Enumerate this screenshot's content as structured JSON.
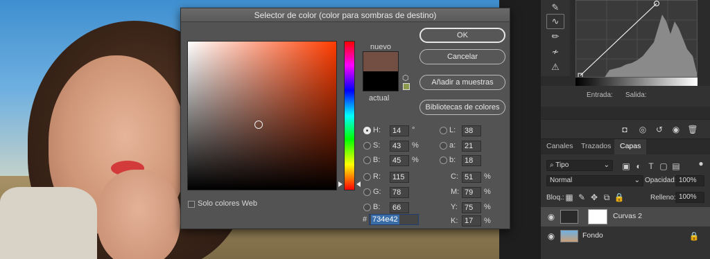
{
  "dialog": {
    "title": "Selector de color (color para sombras de destino)",
    "new_label": "nuevo",
    "current_label": "actual",
    "new_color": "#734e42",
    "current_color": "#000000",
    "buttons": {
      "ok": "OK",
      "cancel": "Cancelar",
      "add_swatches": "Añadir a muestras",
      "color_libraries": "Bibliotecas de colores"
    },
    "web_only_label": "Solo colores Web",
    "hsb": [
      {
        "label": "H:",
        "value": "14",
        "unit": "°"
      },
      {
        "label": "S:",
        "value": "43",
        "unit": "%"
      },
      {
        "label": "B:",
        "value": "45",
        "unit": "%"
      }
    ],
    "rgb": [
      {
        "label": "R:",
        "value": "115"
      },
      {
        "label": "G:",
        "value": "78"
      },
      {
        "label": "B:",
        "value": "66"
      }
    ],
    "lab": [
      {
        "label": "L:",
        "value": "38"
      },
      {
        "label": "a:",
        "value": "21"
      },
      {
        "label": "b:",
        "value": "18"
      }
    ],
    "cmyk": [
      {
        "label": "C:",
        "value": "51",
        "unit": "%"
      },
      {
        "label": "M:",
        "value": "79",
        "unit": "%"
      },
      {
        "label": "Y:",
        "value": "75",
        "unit": "%"
      },
      {
        "label": "K:",
        "value": "17",
        "unit": "%"
      }
    ],
    "hex_prefix": "#",
    "hex": "734e42"
  },
  "curves": {
    "input_label": "Entrada:",
    "output_label": "Salida:"
  },
  "layers_panel": {
    "tabs": [
      "Canales",
      "Trazados",
      "Capas"
    ],
    "active_tab": "Capas",
    "filter": "Tipo",
    "blend_mode": "Normal",
    "opacity_label": "Opacidad:",
    "opacity": "100%",
    "lock_label": "Bloq.:",
    "fill_label": "Relleno:",
    "fill": "100%",
    "layers": [
      {
        "name": "Curvas 2"
      },
      {
        "name": "Fondo"
      }
    ]
  }
}
